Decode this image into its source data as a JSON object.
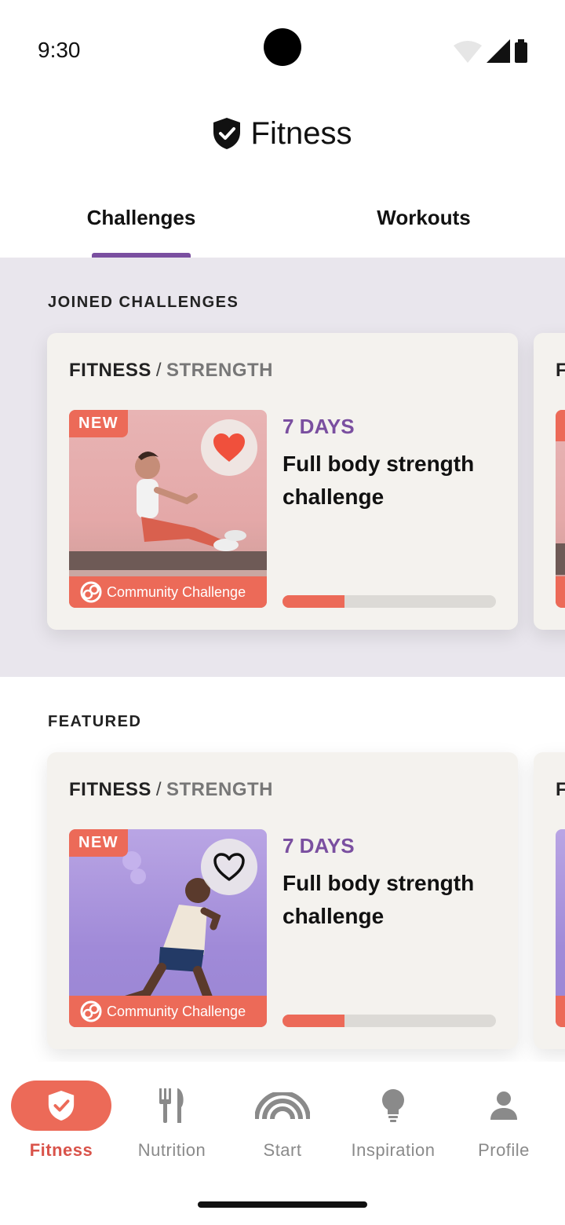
{
  "status_bar": {
    "time": "9:30"
  },
  "header": {
    "title": "Fitness"
  },
  "tabs": [
    {
      "label": "Challenges",
      "active": true
    },
    {
      "label": "Workouts",
      "active": false
    }
  ],
  "joined": {
    "section_title": "JOINED CHALLENGES",
    "cards": [
      {
        "category": "FITNESS",
        "separator": "/",
        "subcategory": "STRENGTH",
        "badge": "NEW",
        "favorited": true,
        "tag": "Community Challenge",
        "duration": "7 DAYS",
        "title": "Full body strength challenge",
        "progress": 0.29
      }
    ],
    "peek_category_initial": "F"
  },
  "featured": {
    "section_title": "FEATURED",
    "cards": [
      {
        "category": "FITNESS",
        "separator": "/",
        "subcategory": "STRENGTH",
        "badge": "NEW",
        "favorited": false,
        "tag": "Community Challenge",
        "duration": "7 DAYS",
        "title": "Full body strength challenge",
        "progress": 0.29
      }
    ],
    "peek_category_initial": "F"
  },
  "bottom_nav": [
    {
      "label": "Fitness",
      "icon": "shield-check-icon",
      "active": true
    },
    {
      "label": "Nutrition",
      "icon": "fork-knife-icon",
      "active": false
    },
    {
      "label": "Start",
      "icon": "rainbow-icon",
      "active": false
    },
    {
      "label": "Inspiration",
      "icon": "lightbulb-icon",
      "active": false
    },
    {
      "label": "Profile",
      "icon": "person-icon",
      "active": false
    }
  ],
  "colors": {
    "accent_purple": "#7a4fa0",
    "accent_coral": "#ec6a58",
    "joined_bg": "#e9e6ed",
    "card_bg": "#f4f2ee"
  }
}
